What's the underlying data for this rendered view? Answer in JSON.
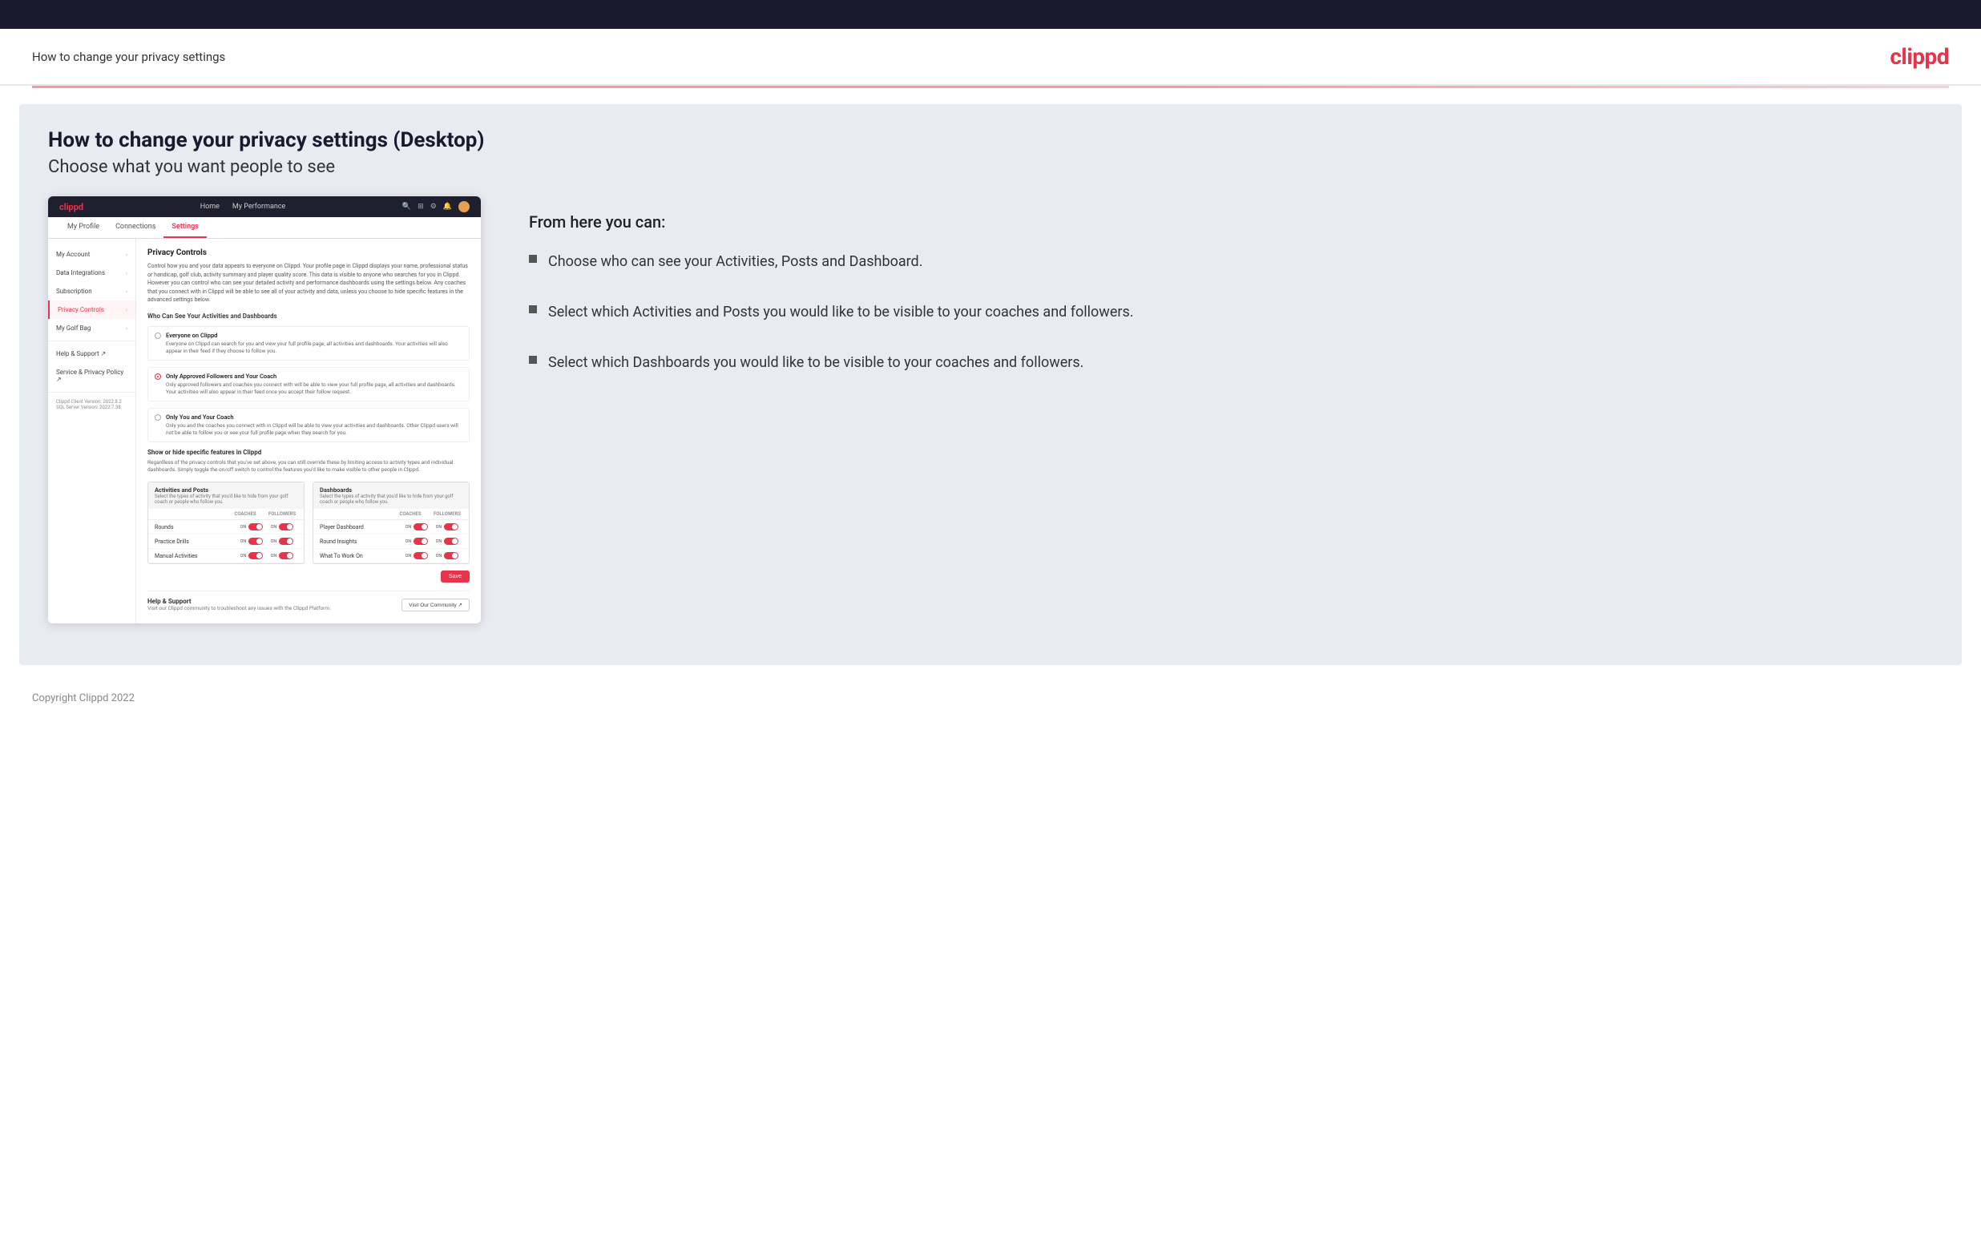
{
  "topbar": {},
  "header": {
    "title": "How to change your privacy settings",
    "logo": "clippd"
  },
  "main": {
    "heading": "How to change your privacy settings (Desktop)",
    "subheading": "Choose what you want people to see",
    "from_here": "From here you can:",
    "bullets": [
      "Choose who can see your Activities, Posts and Dashboard.",
      "Select which Activities and Posts you would like to be visible to your coaches and followers.",
      "Select which Dashboards you would like to be visible to your coaches and followers."
    ]
  },
  "app_screenshot": {
    "nav": {
      "logo": "clippd",
      "links": [
        "Home",
        "My Performance"
      ],
      "icons": [
        "search",
        "grid",
        "settings",
        "bell",
        "avatar"
      ]
    },
    "subnav": [
      "My Profile",
      "Connections",
      "Settings"
    ],
    "active_subnav": "Settings",
    "sidebar": [
      {
        "label": "My Account",
        "has_chevron": true
      },
      {
        "label": "Data Integrations",
        "has_chevron": true
      },
      {
        "label": "Subscription",
        "has_chevron": true
      },
      {
        "label": "Privacy Controls",
        "has_chevron": true,
        "active": true
      },
      {
        "label": "My Golf Bag",
        "has_chevron": true
      },
      {
        "label": "Help & Support",
        "has_chevron": false,
        "external": true
      },
      {
        "label": "Service & Privacy Policy",
        "has_chevron": false,
        "external": true
      }
    ],
    "sidebar_bottom": [
      "Clippd Client Version: 2022.8.2",
      "SQL Server Version: 2022.7.38"
    ],
    "main_panel": {
      "title": "Privacy Controls",
      "description": "Control how you and your data appears to everyone on Clippd. Your profile page in Clippd displays your name, professional status or handicap, golf club, activity summary and player quality score. This data is visible to anyone who searches for you in Clippd. However you can control who can see your detailed activity and performance dashboards using the settings below. Any coaches that you connect with in Clippd will be able to see all of your activity and data, unless you choose to hide specific features in the advanced settings below.",
      "who_can_see_title": "Who Can See Your Activities and Dashboards",
      "radio_options": [
        {
          "label": "Everyone on Clippd",
          "desc": "Everyone on Clippd can search for you and view your full profile page, all activities and dashboards. Your activities will also appear in their feed if they choose to follow you.",
          "selected": false
        },
        {
          "label": "Only Approved Followers and Your Coach",
          "desc": "Only approved followers and coaches you connect with will be able to view your full profile page, all activities and dashboards. Your activities will also appear in their feed once you accept their follow request.",
          "selected": true
        },
        {
          "label": "Only You and Your Coach",
          "desc": "Only you and the coaches you connect with in Clippd will be able to view your activities and dashboards. Other Clippd users will not be able to follow you or see your full profile page when they search for you.",
          "selected": false
        }
      ],
      "show_hide_title": "Show or hide specific features in Clippd",
      "show_hide_desc": "Regardless of the privacy controls that you've set above, you can still override these by limiting access to activity types and individual dashboards. Simply toggle the on/off switch to control the features you'd like to make visible to other people in Clippd.",
      "activities_table": {
        "title": "Activities and Posts",
        "desc": "Select the types of activity that you'd like to hide from your golf coach or people who follow you.",
        "col_headers": [
          "COACHES",
          "FOLLOWERS"
        ],
        "rows": [
          {
            "label": "Rounds",
            "coaches_on": true,
            "followers_on": true
          },
          {
            "label": "Practice Drills",
            "coaches_on": true,
            "followers_on": true
          },
          {
            "label": "Manual Activities",
            "coaches_on": true,
            "followers_on": true
          }
        ]
      },
      "dashboards_table": {
        "title": "Dashboards",
        "desc": "Select the types of activity that you'd like to hide from your golf coach or people who follow you.",
        "col_headers": [
          "COACHES",
          "FOLLOWERS"
        ],
        "rows": [
          {
            "label": "Player Dashboard",
            "coaches_on": true,
            "followers_on": true
          },
          {
            "label": "Round Insights",
            "coaches_on": true,
            "followers_on": true
          },
          {
            "label": "What To Work On",
            "coaches_on": true,
            "followers_on": true
          }
        ]
      },
      "save_button": "Save",
      "help_title": "Help & Support",
      "help_desc": "Visit our Clippd community to troubleshoot any issues with the Clippd Platform.",
      "help_button": "Visit Our Community"
    }
  },
  "footer": {
    "copyright": "Copyright Clippd 2022"
  }
}
